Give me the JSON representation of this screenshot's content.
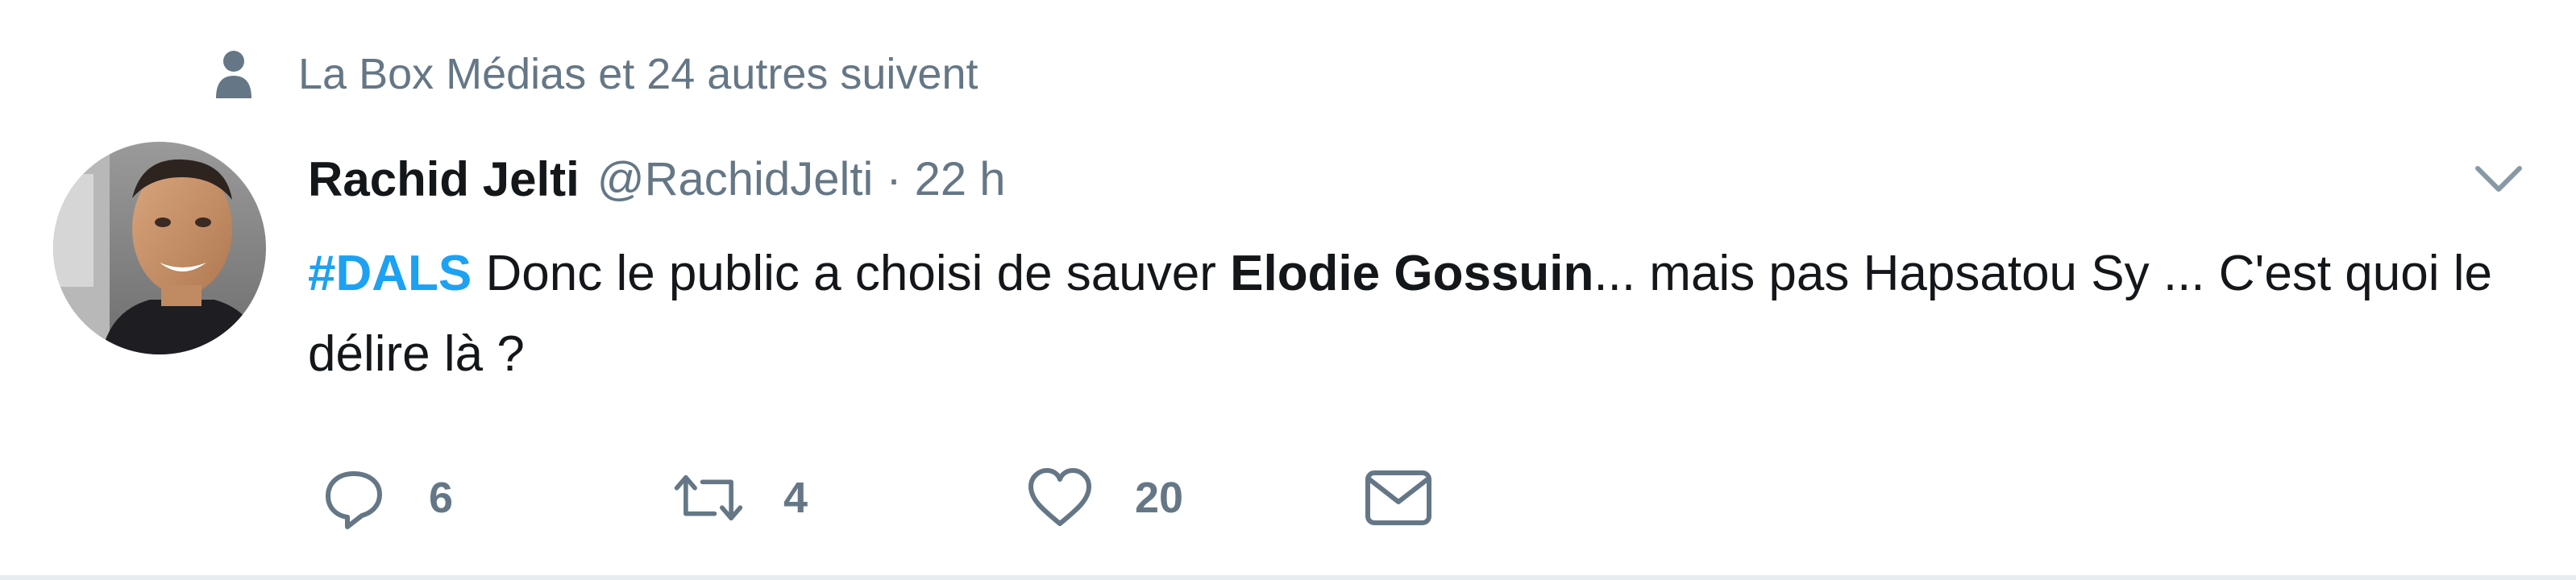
{
  "social_context": {
    "text": "La Box Médias et 24 autres suivent",
    "icon": "person-icon"
  },
  "tweet": {
    "fullname": "Rachid Jelti",
    "username": "@RachidJelti",
    "separator": "·",
    "time": "22 h",
    "text_parts": {
      "hashtag": "#DALS",
      "part1": " Donc le public a choisi de sauver ",
      "bold_name": "Elodie Gossuin",
      "part2": "... mais pas Hapsatou Sy ... C'est quoi le délire là ?"
    },
    "caret_icon": "chevron-down-icon"
  },
  "actions": {
    "reply_count": "6",
    "retweet_count": "4",
    "like_count": "20",
    "icons": [
      "reply-icon",
      "retweet-icon",
      "heart-icon",
      "envelope-icon"
    ]
  },
  "colors": {
    "primary_text": "#14171a",
    "secondary_text": "#657786",
    "hashtag": "#1da1f2",
    "divider": "#e6ecf0"
  }
}
